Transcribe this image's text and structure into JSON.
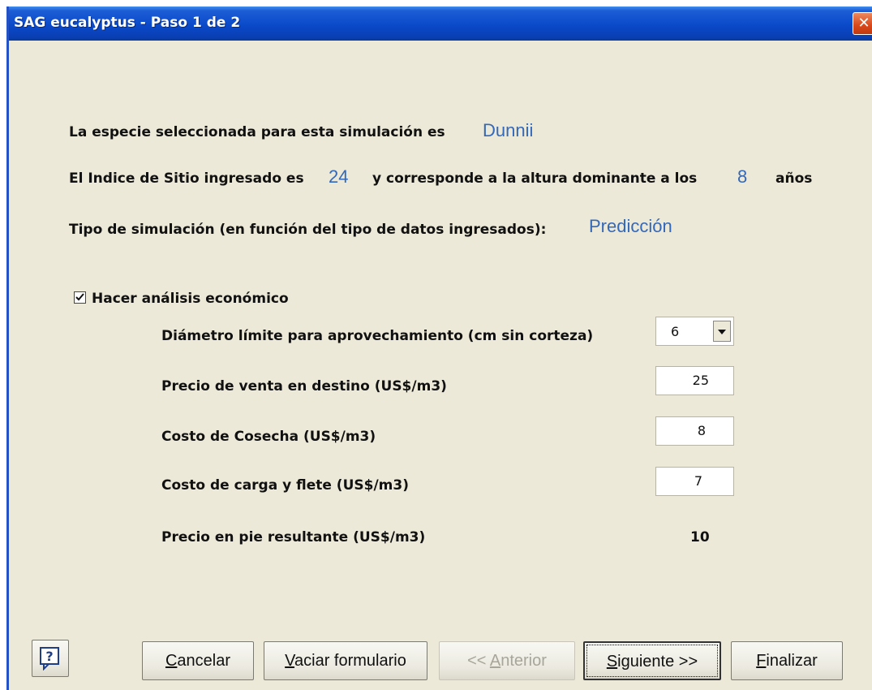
{
  "window": {
    "title": "SAG eucalyptus - Paso 1 de 2",
    "close_glyph": "✕"
  },
  "summary": {
    "species_label": "La especie seleccionada para esta simulación es",
    "species_value": "Dunnii",
    "site_index_label": "El Indice de Sitio ingresado es",
    "site_index_value": "24",
    "site_index_mid": "y corresponde a la altura dominante a los",
    "age_value": "8",
    "age_unit": "años",
    "sim_type_label": "Tipo de simulación (en función del tipo de datos ingresados):",
    "sim_type_value": "Predicción"
  },
  "economic": {
    "checkbox_label": "Hacer análisis económico",
    "checked": true,
    "diameter_label": "Diámetro límite para aprovechamiento (cm sin corteza)",
    "diameter_value": "6",
    "sale_price_label": "Precio de venta en destino (US$/m3)",
    "sale_price_value": "25",
    "harvest_cost_label": "Costo de Cosecha (US$/m3)",
    "harvest_cost_value": "8",
    "freight_cost_label": "Costo de carga y flete (US$/m3)",
    "freight_cost_value": "7",
    "stumpage_label": "Precio en pie resultante (US$/m3)",
    "stumpage_value": "10"
  },
  "buttons": {
    "help_icon": "help-icon",
    "cancel": {
      "first": "C",
      "rest": "ancelar"
    },
    "clear": {
      "first": "V",
      "rest": "aciar formulario"
    },
    "previous": {
      "pre": "<< ",
      "first": "A",
      "rest": "nterior"
    },
    "next": {
      "first": "S",
      "rest": "iguiente >>"
    },
    "finish": {
      "first": "F",
      "rest": "inalizar"
    }
  },
  "colors": {
    "value_blue": "#3468b8",
    "dialog_bg": "#ECE9D8",
    "titlebar_blue": "#0a49c9"
  }
}
